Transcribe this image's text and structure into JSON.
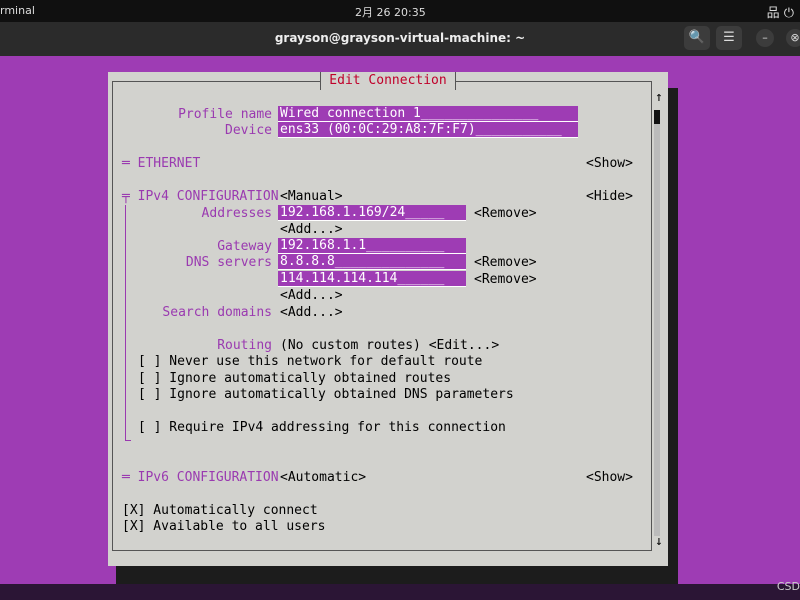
{
  "top": {
    "app": "rminal",
    "clock": "2月 26  20:35",
    "tray": "品 ⏻"
  },
  "window": {
    "title": "grayson@grayson-virtual-machine: ~",
    "search": "🔍",
    "menu": "☰",
    "min": "–",
    "close": "⊗"
  },
  "watermark": "CSD",
  "dialog": {
    "title": "Edit Connection",
    "scroll_up": "↑",
    "scroll_down": "↓"
  },
  "profile": {
    "label": "Profile name",
    "value": "Wired connection 1_______________",
    "device_label": "Device",
    "device_value": "ens33 (00:0C:29:A8:7F:F7)___________"
  },
  "ethernet": {
    "label": "═ ETHERNET",
    "toggle": "<Show>"
  },
  "ipv4": {
    "label": "╤ IPv4 CONFIGURATION",
    "method": "<Manual>",
    "toggle": "<Hide>",
    "addresses_label": "Addresses",
    "address": "192.168.1.169/24_____",
    "remove": "<Remove>",
    "add": "<Add...>",
    "gateway_label": "Gateway",
    "gateway": "192.168.1.1__________",
    "dns_label": "DNS servers",
    "dns1": "8.8.8.8______________",
    "dns2": "114.114.114.114______",
    "search_label": "Search domains",
    "routing_label": "Routing",
    "routing_value": "(No custom routes) <Edit...>",
    "opt1": "[ ] Never use this network for default route",
    "opt2": "[ ] Ignore automatically obtained routes",
    "opt3": "[ ] Ignore automatically obtained DNS parameters",
    "opt4": "[ ] Require IPv4 addressing for this connection"
  },
  "ipv6": {
    "label": "═ IPv6 CONFIGURATION",
    "method": "<Automatic>",
    "toggle": "<Show>"
  },
  "auto_connect": "[X] Automatically connect",
  "all_users": "[X] Available to all users"
}
